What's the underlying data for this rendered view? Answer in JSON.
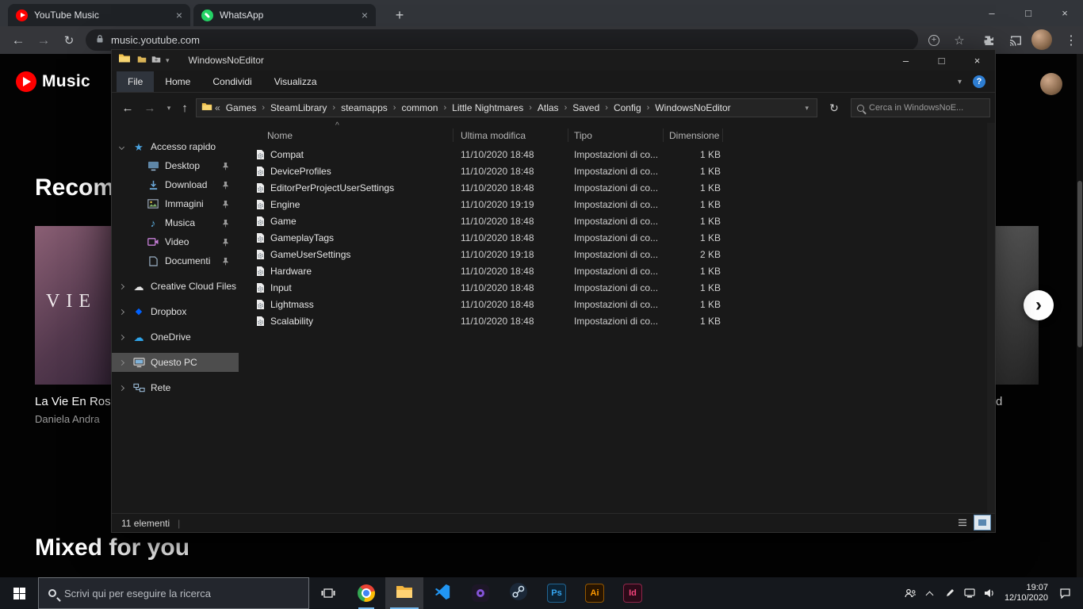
{
  "icons": {
    "back": "←",
    "forward": "→",
    "reload": "↻",
    "up": "↑",
    "dropdown": "▾",
    "crumb_sep": "›",
    "crumb_prefix": "«",
    "sort_caret": "^",
    "menu_dots": "⋮",
    "close": "×",
    "minimize": "–",
    "maximize": "□",
    "new_tab": "+",
    "bookmark_star": "☆",
    "help": "?",
    "next_arrow": "›",
    "plus": "+",
    "quick_access_star": "★",
    "music_note": "♪",
    "cloud": "☁",
    "dropbox_diamond": "◆",
    "separator": "|"
  },
  "browser": {
    "tabs": [
      {
        "title": "YouTube Music"
      },
      {
        "title": "WhatsApp"
      }
    ],
    "url": "music.youtube.com"
  },
  "ytmusic": {
    "logo_text": "Music",
    "section_recommended": "Recomm",
    "card": {
      "art_text": "VIE",
      "title": "La Vie En Ros",
      "subtitle": "Daniela Andra"
    },
    "partial_title": "d",
    "section_mixed": "Mixed for you"
  },
  "explorer": {
    "window_title": "WindowsNoEditor",
    "ribbon_tabs": [
      "File",
      "Home",
      "Condividi",
      "Visualizza"
    ],
    "breadcrumb": [
      "Games",
      "SteamLibrary",
      "steamapps",
      "common",
      "Little Nightmares",
      "Atlas",
      "Saved",
      "Config",
      "WindowsNoEditor"
    ],
    "search_placeholder": "Cerca in WindowsNoE...",
    "columns": {
      "name": "Nome",
      "modified": "Ultima modifica",
      "type": "Tipo",
      "size": "Dimensione"
    },
    "files": [
      {
        "name": "Compat",
        "modified": "11/10/2020 18:48",
        "type": "Impostazioni di co...",
        "size": "1 KB"
      },
      {
        "name": "DeviceProfiles",
        "modified": "11/10/2020 18:48",
        "type": "Impostazioni di co...",
        "size": "1 KB"
      },
      {
        "name": "EditorPerProjectUserSettings",
        "modified": "11/10/2020 18:48",
        "type": "Impostazioni di co...",
        "size": "1 KB"
      },
      {
        "name": "Engine",
        "modified": "11/10/2020 19:19",
        "type": "Impostazioni di co...",
        "size": "1 KB"
      },
      {
        "name": "Game",
        "modified": "11/10/2020 18:48",
        "type": "Impostazioni di co...",
        "size": "1 KB"
      },
      {
        "name": "GameplayTags",
        "modified": "11/10/2020 18:48",
        "type": "Impostazioni di co...",
        "size": "1 KB"
      },
      {
        "name": "GameUserSettings",
        "modified": "11/10/2020 19:18",
        "type": "Impostazioni di co...",
        "size": "2 KB"
      },
      {
        "name": "Hardware",
        "modified": "11/10/2020 18:48",
        "type": "Impostazioni di co...",
        "size": "1 KB"
      },
      {
        "name": "Input",
        "modified": "11/10/2020 18:48",
        "type": "Impostazioni di co...",
        "size": "1 KB"
      },
      {
        "name": "Lightmass",
        "modified": "11/10/2020 18:48",
        "type": "Impostazioni di co...",
        "size": "1 KB"
      },
      {
        "name": "Scalability",
        "modified": "11/10/2020 18:48",
        "type": "Impostazioni di co...",
        "size": "1 KB"
      }
    ],
    "sidebar": [
      {
        "label": "Accesso rapido"
      },
      {
        "label": "Desktop"
      },
      {
        "label": "Download"
      },
      {
        "label": "Immagini"
      },
      {
        "label": "Musica"
      },
      {
        "label": "Video"
      },
      {
        "label": "Documenti"
      },
      {
        "label": "Creative Cloud Files"
      },
      {
        "label": "Dropbox"
      },
      {
        "label": "OneDrive"
      },
      {
        "label": "Questo PC"
      },
      {
        "label": "Rete"
      }
    ],
    "status_items": "11 elementi"
  },
  "taskbar": {
    "search_placeholder": "Scrivi qui per eseguire la ricerca",
    "adobe_labels": {
      "ps": "Ps",
      "ai": "Ai",
      "id": "Id"
    },
    "clock": {
      "time": "19:07",
      "date": "12/10/2020"
    }
  }
}
